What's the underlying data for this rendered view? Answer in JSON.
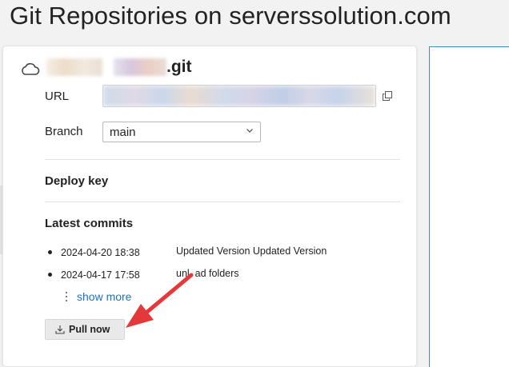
{
  "page": {
    "title": "Git Repositories on serverssolution.com"
  },
  "repo": {
    "name_suffix": ".git",
    "url_label": "URL",
    "branch_label": "Branch",
    "branch_value": "main",
    "deploy_key_title": "Deploy key",
    "latest_commits_title": "Latest commits",
    "commits": [
      {
        "date": "2024-04-20 18:38",
        "message": "Updated Version Updated Version"
      },
      {
        "date": "2024-04-17 17:58",
        "message": "unl  ad folders"
      }
    ],
    "show_more": "show more",
    "pull_button": "Pull now"
  },
  "icons": {
    "repo": "cloud-icon",
    "copy": "copy-icon",
    "dropdown": "chevron-down-icon",
    "more": "kebab-icon",
    "pull": "download-icon"
  },
  "colors": {
    "link": "#1a73c9",
    "annotation_arrow": "#e5383b",
    "panel_border": "#3d8fb6"
  }
}
